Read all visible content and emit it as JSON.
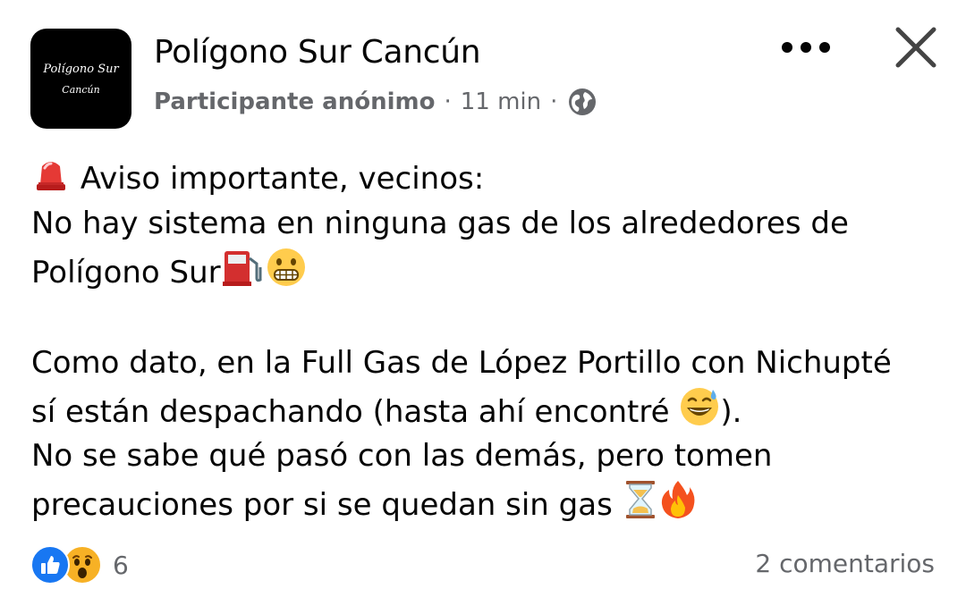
{
  "header": {
    "avatar_line1": "Polígono Sur",
    "avatar_line2": "Cancún",
    "group_name": "Polígono Sur Cancún",
    "author": "Participante anónimo",
    "separator": "·",
    "time": "11 min",
    "privacy_icon": "globe-icon",
    "more_icon": "more-dots-icon",
    "close_icon": "close-icon"
  },
  "post": {
    "line1": "Aviso importante, vecinos:",
    "line2": "No hay sistema en ninguna gas de los alrededores de",
    "line3": "Polígono Sur",
    "line4": "Como dato, en la Full Gas de López Portillo con Nichupté",
    "line5a": "sí están despachando (hasta ahí encontré",
    "line5b": ").",
    "line6": "No se sabe qué pasó con las demás, pero tomen",
    "line7": "precauciones por si se quedan sin gas",
    "emojis": [
      "police-light",
      "fuel-pump",
      "grimacing-face",
      "grinning-sweat-face",
      "hourglass",
      "fire"
    ]
  },
  "footer": {
    "reaction_icons": [
      "like-icon",
      "wow-icon"
    ],
    "reaction_count": "6",
    "comments": "2 comentarios"
  },
  "colors": {
    "text": "#050505",
    "secondary": "#65676b",
    "like_blue": "#1877f2",
    "wow_yellow": "#f7b125"
  }
}
